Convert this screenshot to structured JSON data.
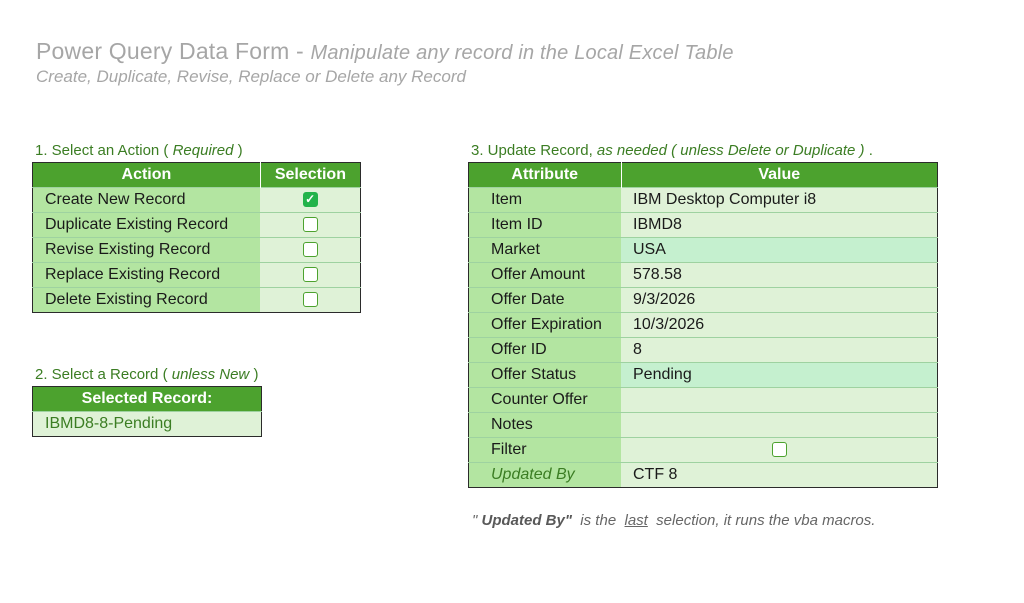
{
  "header": {
    "title_main": "Power Query Data Form - ",
    "title_sub": "Manipulate any record in the Local Excel Table",
    "subtitle": "Create, Duplicate, Revise, Replace or Delete any Record"
  },
  "section1": {
    "label": "1. Select an Action ( ",
    "emph": "Required",
    "suffix": " )"
  },
  "actions": {
    "header_action": "Action",
    "header_selection": "Selection",
    "rows": [
      {
        "label": "Create New Record",
        "checked": true
      },
      {
        "label": "Duplicate Existing Record",
        "checked": false
      },
      {
        "label": "Revise Existing Record",
        "checked": false
      },
      {
        "label": "Replace Existing Record",
        "checked": false
      },
      {
        "label": "Delete Existing Record",
        "checked": false
      }
    ]
  },
  "section2": {
    "label": "2. Select a Record  ( ",
    "emph": "unless New",
    "suffix": " )"
  },
  "selected_record": {
    "header": "Selected Record:",
    "value": "IBMD8-8-Pending"
  },
  "section3": {
    "label": "3. Update Record, ",
    "emph": "as needed ( unless Delete or Duplicate )",
    "suffix": " ."
  },
  "attributes": {
    "header_attribute": "Attribute",
    "header_value": "Value",
    "rows": [
      {
        "name": "Item",
        "value": "IBM Desktop Computer i8"
      },
      {
        "name": "Item ID",
        "value": "IBMD8"
      },
      {
        "name": "Market",
        "value": "USA"
      },
      {
        "name": "Offer Amount",
        "value": "578.58"
      },
      {
        "name": "Offer Date",
        "value": "9/3/2026"
      },
      {
        "name": "Offer Expiration",
        "value": "10/3/2026"
      },
      {
        "name": "Offer ID",
        "value": "8"
      },
      {
        "name": "Offer Status",
        "value": "Pending"
      },
      {
        "name": "Counter Offer",
        "value": ""
      },
      {
        "name": "Notes",
        "value": ""
      },
      {
        "name": "Filter",
        "value": ""
      },
      {
        "name": "Updated By",
        "value": "CTF 8"
      }
    ]
  },
  "footnote": {
    "part1": "\" ",
    "bold": "Updated By\"",
    "part2": "  is the  ",
    "underline": "last",
    "part3": "  selection, it runs the vba macros."
  },
  "colors": {
    "green_header": "#4ca22e",
    "green_light": "#b3e5a1",
    "green_pale": "#dff2d7",
    "text_gray": "#a6a6a6",
    "label_green": "#3b7d23"
  },
  "icons": {
    "checked": "checkbox-checked-icon",
    "unchecked": "checkbox-empty-icon"
  }
}
